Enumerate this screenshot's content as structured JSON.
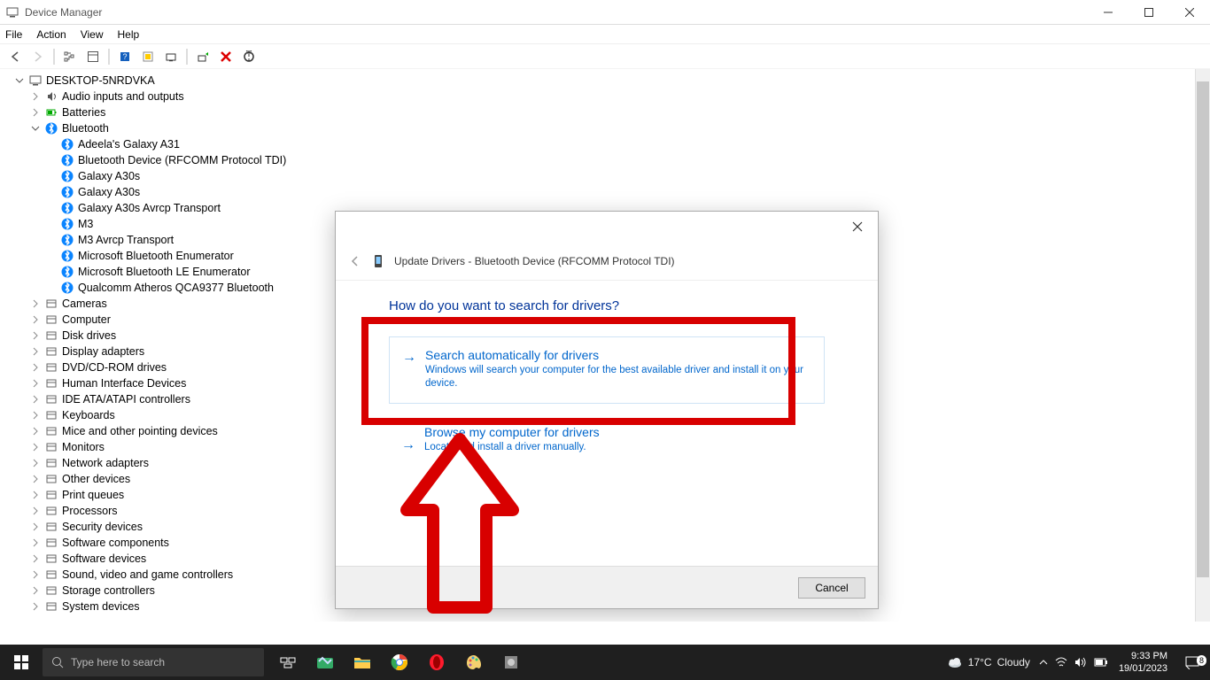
{
  "window": {
    "title": "Device Manager",
    "menu": [
      "File",
      "Action",
      "View",
      "Help"
    ]
  },
  "tree": {
    "root": "DESKTOP-5NRDVKA",
    "audio": "Audio inputs and outputs",
    "batteries": "Batteries",
    "bluetooth": "Bluetooth",
    "bt_items": [
      "Adeela's Galaxy A31",
      "Bluetooth Device (RFCOMM Protocol TDI)",
      "Galaxy A30s",
      "Galaxy A30s",
      "Galaxy A30s Avrcp Transport",
      "M3",
      "M3 Avrcp Transport",
      "Microsoft Bluetooth Enumerator",
      "Microsoft Bluetooth LE Enumerator",
      "Qualcomm Atheros QCA9377 Bluetooth"
    ],
    "categories": [
      "Cameras",
      "Computer",
      "Disk drives",
      "Display adapters",
      "DVD/CD-ROM drives",
      "Human Interface Devices",
      "IDE ATA/ATAPI controllers",
      "Keyboards",
      "Mice and other pointing devices",
      "Monitors",
      "Network adapters",
      "Other devices",
      "Print queues",
      "Processors",
      "Security devices",
      "Software components",
      "Software devices",
      "Sound, video and game controllers",
      "Storage controllers",
      "System devices"
    ]
  },
  "dialog": {
    "title": "Update Drivers - Bluetooth Device (RFCOMM Protocol TDI)",
    "question": "How do you want to search for drivers?",
    "opt1_title": "Search automatically for drivers",
    "opt1_desc": "Windows will search your computer for the best available driver and install it on your device.",
    "opt2_title": "Browse my computer for drivers",
    "opt2_desc": "Locate and install a driver manually.",
    "cancel": "Cancel"
  },
  "taskbar": {
    "search_placeholder": "Type here to search",
    "weather_temp": "17°C",
    "weather_cond": "Cloudy",
    "time": "9:33 PM",
    "date": "19/01/2023",
    "noti_count": "8"
  }
}
